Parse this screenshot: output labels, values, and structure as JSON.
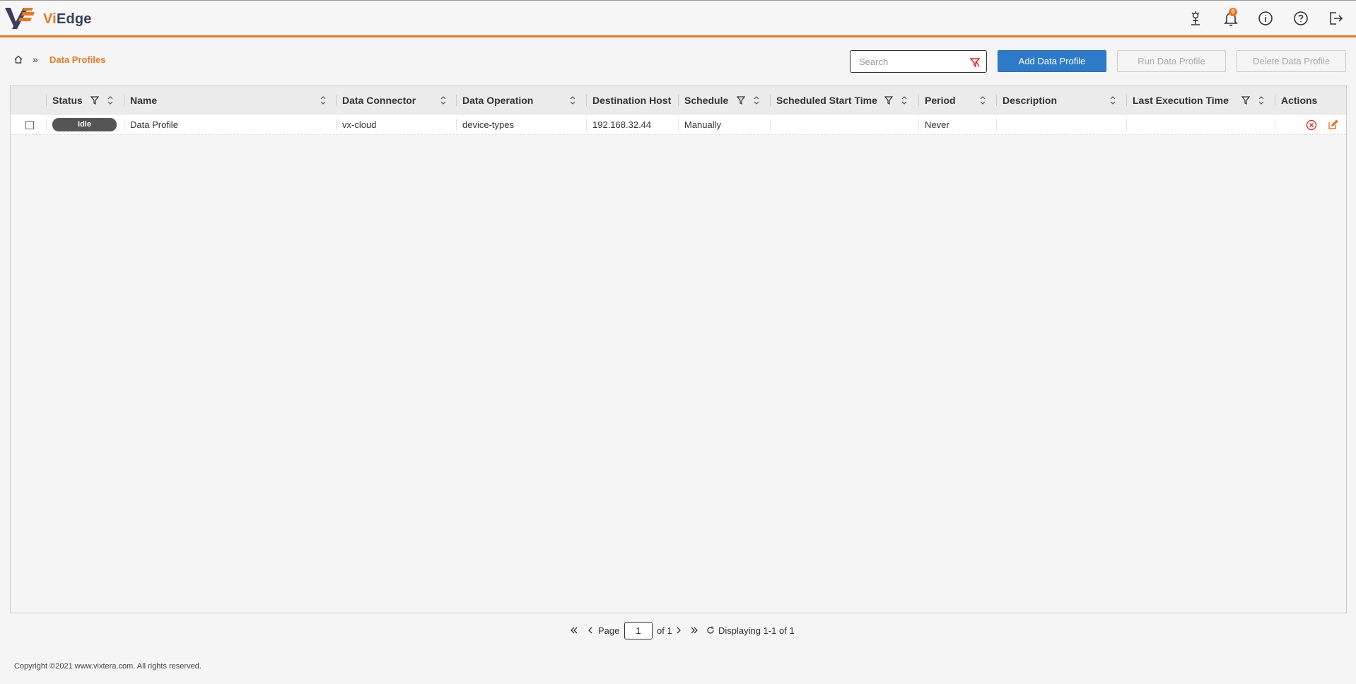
{
  "app": {
    "brand_prefix": "Vi",
    "brand_suffix": "Edge",
    "accent_color": "#e87722",
    "primary_color": "#2d7ac9"
  },
  "header": {
    "icons": [
      "deploy-icon",
      "bell-icon",
      "info-icon",
      "help-icon",
      "logout-icon"
    ],
    "notification_count": "0"
  },
  "breadcrumb": {
    "separator": "»",
    "current": "Data Profiles"
  },
  "toolbar": {
    "search_placeholder": "Search",
    "add_label": "Add Data Profile",
    "run_label": "Run Data Profile",
    "delete_label": "Delete Data Profile"
  },
  "table": {
    "columns": [
      {
        "label": "Status"
      },
      {
        "label": "Name"
      },
      {
        "label": "Data Connector"
      },
      {
        "label": "Data Operation"
      },
      {
        "label": "Destination Host"
      },
      {
        "label": "Schedule"
      },
      {
        "label": "Scheduled Start Time"
      },
      {
        "label": "Period"
      },
      {
        "label": "Description"
      },
      {
        "label": "Last Execution Time"
      },
      {
        "label": "Actions"
      }
    ],
    "rows": [
      {
        "status": "Idle",
        "name": "Data Profile",
        "data_connector": "vx-cloud",
        "data_operation": "device-types",
        "destination_host": "192.168.32.44",
        "schedule": "Manually",
        "scheduled_start_time": "",
        "period": "Never",
        "description": "",
        "last_execution_time": ""
      }
    ]
  },
  "pager": {
    "page_label": "Page",
    "current_page": "1",
    "of_label": "of 1",
    "display_text": "Displaying 1-1 of 1"
  },
  "footer": {
    "copyright": "Copyright ©2021 www.vixtera.com. All rights reserved."
  }
}
